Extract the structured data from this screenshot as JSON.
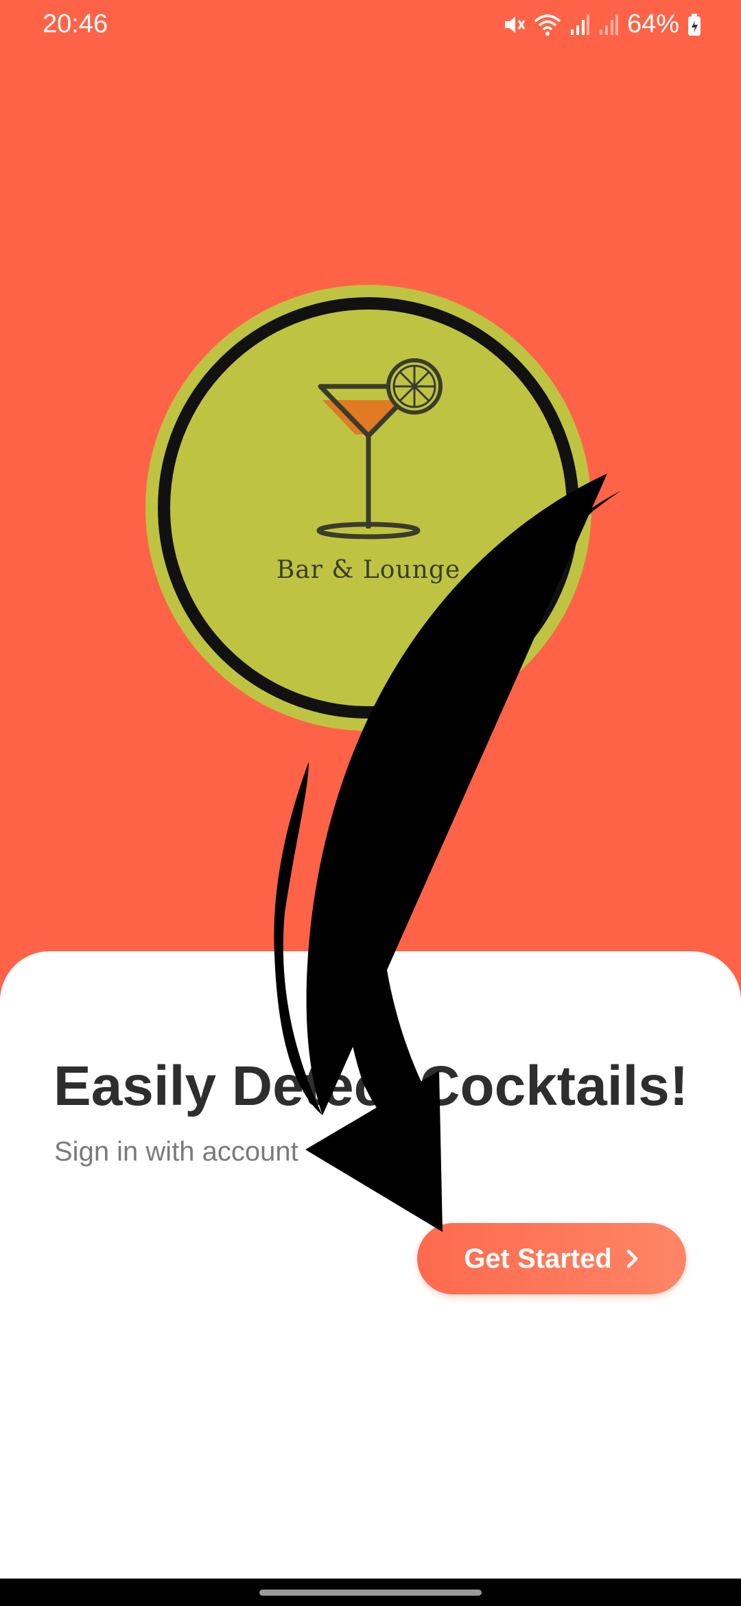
{
  "status_bar": {
    "time": "20:46",
    "battery": "64%",
    "icons": [
      "mute-icon",
      "wifi-icon",
      "signal-icon",
      "signal-icon-2",
      "battery-icon"
    ]
  },
  "logo": {
    "label": "Bar & Lounge",
    "icon": "cocktail-glass-icon",
    "colors": {
      "circle": "#BEC441",
      "ring": "#111111",
      "drink": "#E07A23"
    }
  },
  "sheet": {
    "headline": "Easily Detect Cocktails!",
    "subtitle": "Sign in with account",
    "cta_label": "Get Started",
    "cta_icon": "chevron-right-icon"
  },
  "colors": {
    "background": "#FF6347",
    "sheet": "#FFFFFF",
    "headline": "#2E2E2E",
    "subtitle": "#7A7A7A",
    "button": "#FF7355"
  }
}
